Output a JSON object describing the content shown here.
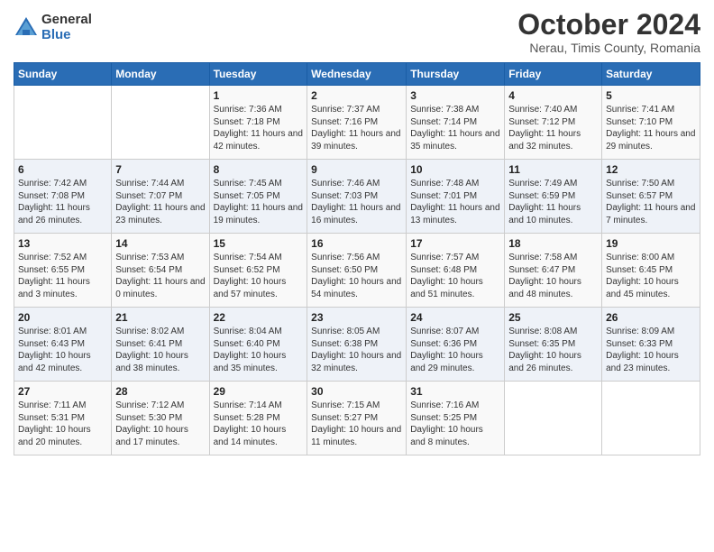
{
  "header": {
    "logo_general": "General",
    "logo_blue": "Blue",
    "month_title": "October 2024",
    "location": "Nerau, Timis County, Romania"
  },
  "calendar": {
    "days_of_week": [
      "Sunday",
      "Monday",
      "Tuesday",
      "Wednesday",
      "Thursday",
      "Friday",
      "Saturday"
    ],
    "weeks": [
      [
        {
          "day": "",
          "info": ""
        },
        {
          "day": "",
          "info": ""
        },
        {
          "day": "1",
          "info": "Sunrise: 7:36 AM\nSunset: 7:18 PM\nDaylight: 11 hours and 42 minutes."
        },
        {
          "day": "2",
          "info": "Sunrise: 7:37 AM\nSunset: 7:16 PM\nDaylight: 11 hours and 39 minutes."
        },
        {
          "day": "3",
          "info": "Sunrise: 7:38 AM\nSunset: 7:14 PM\nDaylight: 11 hours and 35 minutes."
        },
        {
          "day": "4",
          "info": "Sunrise: 7:40 AM\nSunset: 7:12 PM\nDaylight: 11 hours and 32 minutes."
        },
        {
          "day": "5",
          "info": "Sunrise: 7:41 AM\nSunset: 7:10 PM\nDaylight: 11 hours and 29 minutes."
        }
      ],
      [
        {
          "day": "6",
          "info": "Sunrise: 7:42 AM\nSunset: 7:08 PM\nDaylight: 11 hours and 26 minutes."
        },
        {
          "day": "7",
          "info": "Sunrise: 7:44 AM\nSunset: 7:07 PM\nDaylight: 11 hours and 23 minutes."
        },
        {
          "day": "8",
          "info": "Sunrise: 7:45 AM\nSunset: 7:05 PM\nDaylight: 11 hours and 19 minutes."
        },
        {
          "day": "9",
          "info": "Sunrise: 7:46 AM\nSunset: 7:03 PM\nDaylight: 11 hours and 16 minutes."
        },
        {
          "day": "10",
          "info": "Sunrise: 7:48 AM\nSunset: 7:01 PM\nDaylight: 11 hours and 13 minutes."
        },
        {
          "day": "11",
          "info": "Sunrise: 7:49 AM\nSunset: 6:59 PM\nDaylight: 11 hours and 10 minutes."
        },
        {
          "day": "12",
          "info": "Sunrise: 7:50 AM\nSunset: 6:57 PM\nDaylight: 11 hours and 7 minutes."
        }
      ],
      [
        {
          "day": "13",
          "info": "Sunrise: 7:52 AM\nSunset: 6:55 PM\nDaylight: 11 hours and 3 minutes."
        },
        {
          "day": "14",
          "info": "Sunrise: 7:53 AM\nSunset: 6:54 PM\nDaylight: 11 hours and 0 minutes."
        },
        {
          "day": "15",
          "info": "Sunrise: 7:54 AM\nSunset: 6:52 PM\nDaylight: 10 hours and 57 minutes."
        },
        {
          "day": "16",
          "info": "Sunrise: 7:56 AM\nSunset: 6:50 PM\nDaylight: 10 hours and 54 minutes."
        },
        {
          "day": "17",
          "info": "Sunrise: 7:57 AM\nSunset: 6:48 PM\nDaylight: 10 hours and 51 minutes."
        },
        {
          "day": "18",
          "info": "Sunrise: 7:58 AM\nSunset: 6:47 PM\nDaylight: 10 hours and 48 minutes."
        },
        {
          "day": "19",
          "info": "Sunrise: 8:00 AM\nSunset: 6:45 PM\nDaylight: 10 hours and 45 minutes."
        }
      ],
      [
        {
          "day": "20",
          "info": "Sunrise: 8:01 AM\nSunset: 6:43 PM\nDaylight: 10 hours and 42 minutes."
        },
        {
          "day": "21",
          "info": "Sunrise: 8:02 AM\nSunset: 6:41 PM\nDaylight: 10 hours and 38 minutes."
        },
        {
          "day": "22",
          "info": "Sunrise: 8:04 AM\nSunset: 6:40 PM\nDaylight: 10 hours and 35 minutes."
        },
        {
          "day": "23",
          "info": "Sunrise: 8:05 AM\nSunset: 6:38 PM\nDaylight: 10 hours and 32 minutes."
        },
        {
          "day": "24",
          "info": "Sunrise: 8:07 AM\nSunset: 6:36 PM\nDaylight: 10 hours and 29 minutes."
        },
        {
          "day": "25",
          "info": "Sunrise: 8:08 AM\nSunset: 6:35 PM\nDaylight: 10 hours and 26 minutes."
        },
        {
          "day": "26",
          "info": "Sunrise: 8:09 AM\nSunset: 6:33 PM\nDaylight: 10 hours and 23 minutes."
        }
      ],
      [
        {
          "day": "27",
          "info": "Sunrise: 7:11 AM\nSunset: 5:31 PM\nDaylight: 10 hours and 20 minutes."
        },
        {
          "day": "28",
          "info": "Sunrise: 7:12 AM\nSunset: 5:30 PM\nDaylight: 10 hours and 17 minutes."
        },
        {
          "day": "29",
          "info": "Sunrise: 7:14 AM\nSunset: 5:28 PM\nDaylight: 10 hours and 14 minutes."
        },
        {
          "day": "30",
          "info": "Sunrise: 7:15 AM\nSunset: 5:27 PM\nDaylight: 10 hours and 11 minutes."
        },
        {
          "day": "31",
          "info": "Sunrise: 7:16 AM\nSunset: 5:25 PM\nDaylight: 10 hours and 8 minutes."
        },
        {
          "day": "",
          "info": ""
        },
        {
          "day": "",
          "info": ""
        }
      ]
    ]
  }
}
